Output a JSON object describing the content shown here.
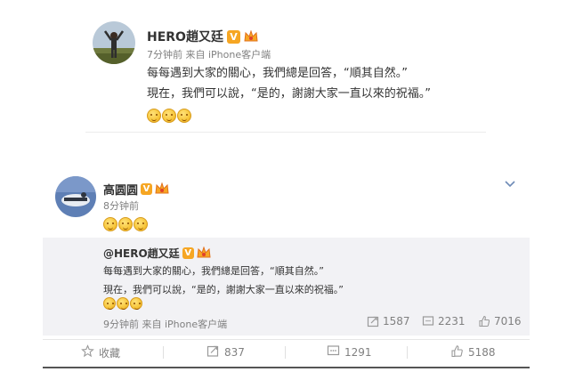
{
  "post1": {
    "author": "HERO趙又廷",
    "meta": "7分钟前 来自 iPhone客户端",
    "line1": "每每遇到大家的關心，我們總是回答，“順其自然。”",
    "line2": "現在，我們可以說，“是的，謝謝大家一直以來的祝福。”",
    "emoji_count": 3
  },
  "post2": {
    "author": "高圆圆",
    "meta": "8分钟前",
    "emoji_count": 3
  },
  "repost": {
    "author": "@HERO趙又廷",
    "line1": "每每遇到大家的關心，我們總是回答，“順其自然。”",
    "line2": "現在，我們可以說，“是的，謝謝大家一直以來的祝福。”",
    "meta": "9分钟前 来自 iPhone客户端",
    "reposts": "1587",
    "comments": "2231",
    "likes": "7016"
  },
  "actions": {
    "favorite": "收藏",
    "repost": "837",
    "comment": "1291",
    "like": "5188"
  },
  "colors": {
    "verified": "#f6a623",
    "meta": "#808080",
    "box": "#f2f2f5"
  },
  "icons": [
    "verified-v-icon",
    "crown-badge-icon",
    "chevron-down-icon",
    "star-icon",
    "repost-icon",
    "comment-icon",
    "thumbs-up-icon"
  ]
}
